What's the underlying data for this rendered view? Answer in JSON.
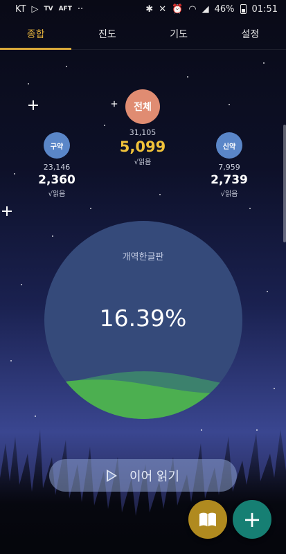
{
  "status_bar": {
    "carrier": "KT",
    "mini_labels": [
      "TV",
      "AFT"
    ],
    "battery": "46%",
    "time": "01:51"
  },
  "tabs": [
    {
      "label": "종합",
      "active": true
    },
    {
      "label": "진도",
      "active": false
    },
    {
      "label": "기도",
      "active": false
    },
    {
      "label": "설정",
      "active": false
    }
  ],
  "stats": {
    "total": {
      "badge": "전체",
      "total_verses": "31,105",
      "read_count": "5,099",
      "read_label": "√읽음"
    },
    "old_testament": {
      "badge": "구약",
      "total_verses": "23,146",
      "read_count": "2,360",
      "read_label": "√읽음"
    },
    "new_testament": {
      "badge": "신약",
      "total_verses": "7,959",
      "read_count": "2,739",
      "read_label": "√읽음"
    }
  },
  "progress": {
    "translation": "개역한글판",
    "percent_text": "16.39%",
    "fraction": 0.1639
  },
  "continue_button": {
    "label": "이어 읽기"
  },
  "fabs": {
    "book_icon": "book-icon",
    "add_icon": "plus-icon",
    "add_symbol": "+"
  },
  "colors": {
    "accent": "#d8a93a",
    "total_badge": "#e08c72",
    "testament_badge": "#5a86c8",
    "read_highlight": "#f0c23a",
    "progress_fill": "#4caf50",
    "circle": "#354a7a",
    "fab_book": "#b08a1f",
    "fab_add": "#167f73"
  }
}
